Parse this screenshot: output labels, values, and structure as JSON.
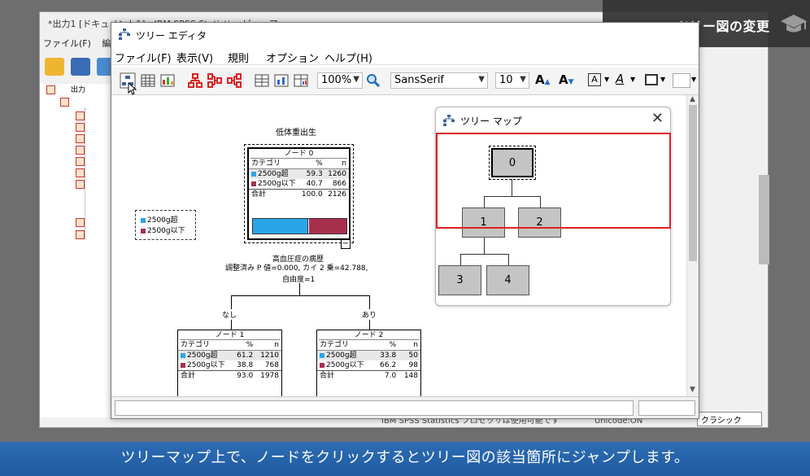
{
  "background_window": {
    "title": "*出力1 [ドキュメント1] - IBM SPSS Statistics ビューア",
    "menu": [
      "ファイル(F)",
      "編集"
    ],
    "status_text": "IBM SPSS Statistics プロセッサは使用可能です",
    "encoding": "Unicode:ON",
    "classic_button": "クラシック",
    "tree_output_label": "出力"
  },
  "title_tag": {
    "text": "ツリー図の変更",
    "icon": "graduation-cap-icon"
  },
  "caption": "ツリーマップ上で、ノードをクリックするとツリー図の該当箇所にジャンプします。",
  "editor": {
    "title": "ツリー エディタ",
    "menu": [
      "ファイル(F)",
      "表示(V)",
      "規則",
      "オプション",
      "ヘルプ(H)"
    ],
    "toolbar": {
      "zoom": "100%",
      "font": "SansSerif",
      "font_size": "10"
    }
  },
  "tree": {
    "title": "低体重出生",
    "legend": [
      {
        "label": "2500g超",
        "color": "#2aa6e8"
      },
      {
        "label": "2500g以下",
        "color": "#a8304f"
      }
    ],
    "col_headers": [
      "カテゴリ",
      "%",
      "n"
    ],
    "total_label": "合計",
    "node0": {
      "title": "ノード 0",
      "rows": [
        {
          "cat": "2500g超",
          "pct": "59.3",
          "n": "1260"
        },
        {
          "cat": "2500g以下",
          "pct": "40.7",
          "n": "866"
        }
      ],
      "total_pct": "100.0",
      "total_n": "2126",
      "bar_fraction": 0.593
    },
    "split": {
      "variable": "高血圧症の病歴",
      "stats": "調整済み P 値=0.000, カイ 2 乗=42.788,",
      "df": "自由度=1"
    },
    "branch_left": "なし",
    "branch_right": "あり",
    "node1": {
      "title": "ノード 1",
      "rows": [
        {
          "cat": "2500g超",
          "pct": "61.2",
          "n": "1210"
        },
        {
          "cat": "2500g以下",
          "pct": "38.8",
          "n": "768"
        }
      ],
      "total_pct": "93.0",
      "total_n": "1978"
    },
    "node2": {
      "title": "ノード 2",
      "rows": [
        {
          "cat": "2500g超",
          "pct": "33.8",
          "n": "50"
        },
        {
          "cat": "2500g以下",
          "pct": "66.2",
          "n": "98"
        }
      ],
      "total_pct": "7.0",
      "total_n": "148"
    }
  },
  "treemap": {
    "title": "ツリー マップ",
    "close": "✕",
    "nodes": [
      "0",
      "1",
      "2",
      "3",
      "4"
    ],
    "viewport_color": "#e02020"
  }
}
